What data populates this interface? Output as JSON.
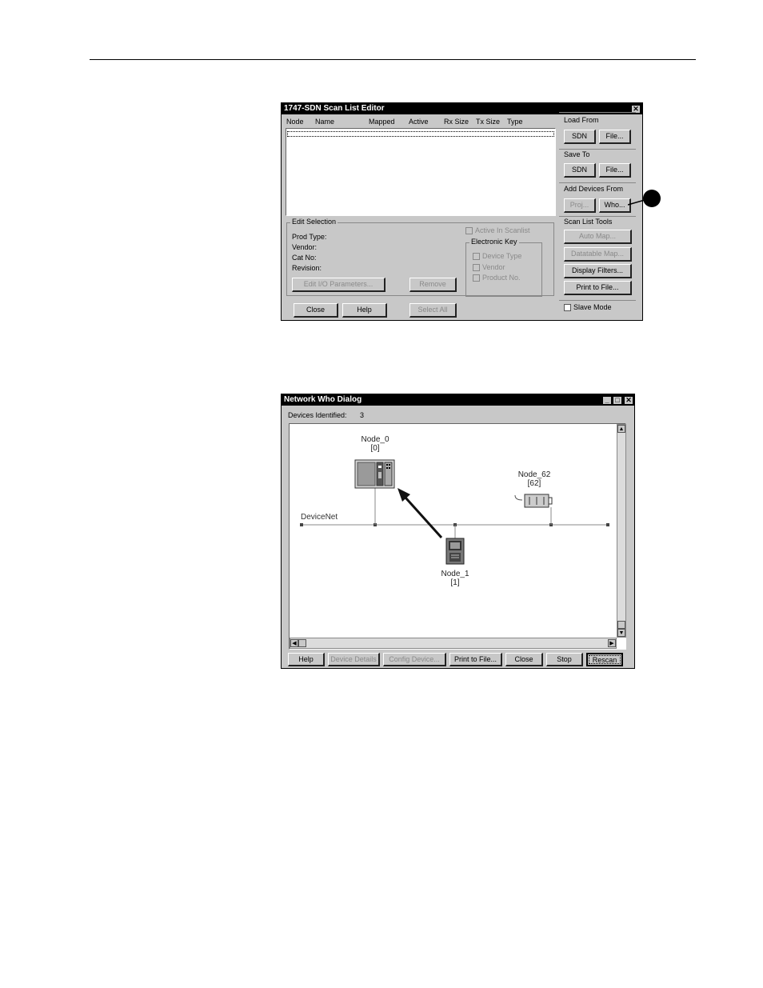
{
  "scan_list_editor": {
    "title": "1747-SDN Scan List Editor",
    "columns": [
      "Node",
      "Name",
      "Mapped",
      "Active",
      "Rx Size",
      "Tx Size",
      "Type"
    ],
    "load_from": {
      "label": "Load From",
      "sdn": "SDN",
      "file": "File..."
    },
    "save_to": {
      "label": "Save To",
      "sdn": "SDN",
      "file": "File..."
    },
    "add_devices_from": {
      "label": "Add Devices From",
      "proj": "Proj...",
      "who": "Who..."
    },
    "scan_list_tools": {
      "label": "Scan List Tools",
      "automap": "Auto Map...",
      "datatable_map": "Datatable Map...",
      "display_filters": "Display Filters...",
      "print_to_file": "Print to File..."
    },
    "edit_selection": {
      "label": "Edit Selection",
      "prod_type": "Prod Type:",
      "vendor": "Vendor:",
      "cat_no": "Cat No:",
      "revision": "Revision:",
      "edit_io": "Edit I/O Parameters...",
      "remove": "Remove",
      "active_in_scanlist": "Active In Scanlist",
      "electronic_key": "Electronic Key",
      "device_type": "Device Type",
      "vendor_chk": "Vendor",
      "product_no": "Product No."
    },
    "close": "Close",
    "help": "Help",
    "select_all": "Select All",
    "slave_mode": "Slave Mode"
  },
  "network_who": {
    "title": "Network Who Dialog",
    "devices_identified_label": "Devices Identified:",
    "devices_identified_value": "3",
    "network_label": "DeviceNet",
    "nodes": [
      {
        "name": "Node_0",
        "address": "[0]"
      },
      {
        "name": "Node_1",
        "address": "[1]"
      },
      {
        "name": "Node_62",
        "address": "[62]"
      }
    ],
    "buttons": {
      "help": "Help",
      "device_details": "Device Details",
      "config_device": "Config Device...",
      "print_to_file": "Print to File...",
      "close": "Close",
      "stop": "Stop",
      "rescan": "Rescan"
    }
  }
}
